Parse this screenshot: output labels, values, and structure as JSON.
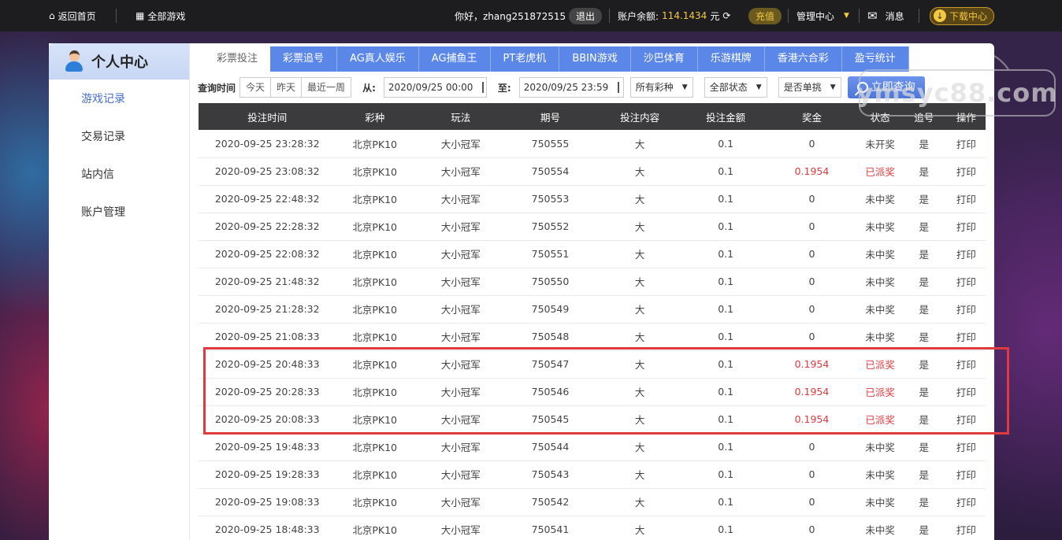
{
  "topbar": {
    "home": "返回首页",
    "all_games": "全部游戏",
    "greeting": "你好，zhang251872515",
    "logout": "退出",
    "balance_label": "账户余额:",
    "balance_value": "114.1434",
    "balance_unit": "元",
    "recharge": "充值",
    "admin_center": "管理中心",
    "messages": "消息",
    "download": "下载中心"
  },
  "sidebar": {
    "title": "个人中心",
    "items": [
      {
        "label": "游戏记录",
        "active": true
      },
      {
        "label": "交易记录"
      },
      {
        "label": "站内信"
      },
      {
        "label": "账户管理"
      }
    ]
  },
  "tabs": [
    "彩票投注",
    "彩票追号",
    "AG真人娱乐",
    "AG捕鱼王",
    "PT老虎机",
    "BBIN游戏",
    "沙巴体育",
    "乐游棋牌",
    "香港六合彩",
    "盈亏统计"
  ],
  "filter": {
    "label": "查询时间",
    "today": "今天",
    "yesterday": "昨天",
    "last_week": "最近一周",
    "from_label": "从:",
    "from_value": "2020/09/25 00:00",
    "to_label": "至:",
    "to_value": "2020/09/25 23:59",
    "lottery_select": "所有彩种",
    "status_select": "全部状态",
    "single_select": "是否单挑",
    "query_button": "立即查询"
  },
  "table": {
    "headers": [
      "投注时间",
      "彩种",
      "玩法",
      "期号",
      "投注内容",
      "投注金额",
      "奖金",
      "状态",
      "追号",
      "操作"
    ],
    "rows": [
      [
        "2020-09-25 23:28:32",
        "北京PK10",
        "大小冠军",
        "750555",
        "大",
        "0.1",
        "0",
        "未开奖",
        "是",
        "打印"
      ],
      [
        "2020-09-25 23:08:32",
        "北京PK10",
        "大小冠军",
        "750554",
        "大",
        "0.1",
        "0.1954",
        "已派奖",
        "是",
        "打印"
      ],
      [
        "2020-09-25 22:48:32",
        "北京PK10",
        "大小冠军",
        "750553",
        "大",
        "0.1",
        "0",
        "未中奖",
        "是",
        "打印"
      ],
      [
        "2020-09-25 22:28:32",
        "北京PK10",
        "大小冠军",
        "750552",
        "大",
        "0.1",
        "0",
        "未中奖",
        "是",
        "打印"
      ],
      [
        "2020-09-25 22:08:32",
        "北京PK10",
        "大小冠军",
        "750551",
        "大",
        "0.1",
        "0",
        "未中奖",
        "是",
        "打印"
      ],
      [
        "2020-09-25 21:48:32",
        "北京PK10",
        "大小冠军",
        "750550",
        "大",
        "0.1",
        "0",
        "未中奖",
        "是",
        "打印"
      ],
      [
        "2020-09-25 21:28:32",
        "北京PK10",
        "大小冠军",
        "750549",
        "大",
        "0.1",
        "0",
        "未中奖",
        "是",
        "打印"
      ],
      [
        "2020-09-25 21:08:33",
        "北京PK10",
        "大小冠军",
        "750548",
        "大",
        "0.1",
        "0",
        "未中奖",
        "是",
        "打印"
      ],
      [
        "2020-09-25 20:48:33",
        "北京PK10",
        "大小冠军",
        "750547",
        "大",
        "0.1",
        "0.1954",
        "已派奖",
        "是",
        "打印"
      ],
      [
        "2020-09-25 20:28:33",
        "北京PK10",
        "大小冠军",
        "750546",
        "大",
        "0.1",
        "0.1954",
        "已派奖",
        "是",
        "打印"
      ],
      [
        "2020-09-25 20:08:33",
        "北京PK10",
        "大小冠军",
        "750545",
        "大",
        "0.1",
        "0.1954",
        "已派奖",
        "是",
        "打印"
      ],
      [
        "2020-09-25 19:48:33",
        "北京PK10",
        "大小冠军",
        "750544",
        "大",
        "0.1",
        "0",
        "未中奖",
        "是",
        "打印"
      ],
      [
        "2020-09-25 19:28:33",
        "北京PK10",
        "大小冠军",
        "750543",
        "大",
        "0.1",
        "0",
        "未中奖",
        "是",
        "打印"
      ],
      [
        "2020-09-25 19:08:33",
        "北京PK10",
        "大小冠军",
        "750542",
        "大",
        "0.1",
        "0",
        "未中奖",
        "是",
        "打印"
      ],
      [
        "2020-09-25 18:48:33",
        "北京PK10",
        "大小冠军",
        "750541",
        "大",
        "0.1",
        "0",
        "未中奖",
        "是",
        "打印"
      ]
    ]
  },
  "watermark": "ymsyc88.com",
  "colors": {
    "accent_blue": "#5b87e8",
    "paid_red": "#e0393e",
    "balance_gold": "#f5c842"
  }
}
